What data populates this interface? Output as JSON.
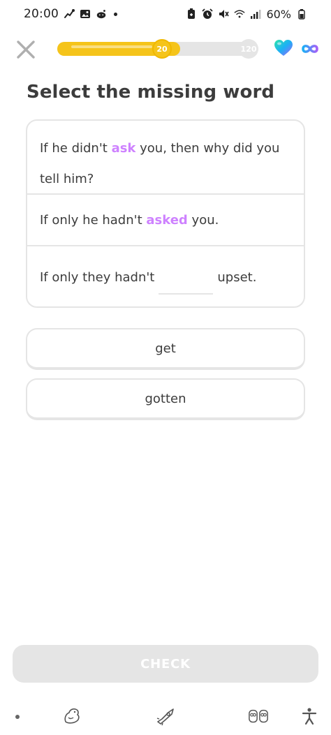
{
  "status_bar": {
    "time": "20:00",
    "battery": "60%",
    "icons": [
      "path-icon",
      "image-icon",
      "reddit-icon",
      "notification-dot",
      "battery-saver-icon",
      "alarm-icon",
      "mute-icon",
      "wifi-icon",
      "signal-icon",
      "battery-icon"
    ]
  },
  "header": {
    "close_icon": "close-icon",
    "progress": {
      "current": "20",
      "total": "120",
      "fraction": 0.61,
      "color": "#f5c41a"
    },
    "hearts_icon": "heart-gradient-icon",
    "hearts_value_icon": "infinity-icon",
    "accent": "#1cb0f6"
  },
  "exercise": {
    "title": "Select the missing word",
    "sentences": [
      {
        "before": "If he didn't ",
        "highlight": "ask",
        "after": " you, then why did you tell him?"
      },
      {
        "before": "If only he hadn't ",
        "highlight": "asked",
        "after": " you."
      },
      {
        "before": "If only they hadn't",
        "after": "upset."
      }
    ],
    "highlight_color": "#ce82ff",
    "options": [
      "get",
      "gotten"
    ]
  },
  "footer": {
    "check_label": "CHECK",
    "check_disabled": true
  },
  "bottom_nav": {
    "items": [
      "dot-icon",
      "dino-icon",
      "rocket-icon",
      "owls-icon",
      "accessibility-icon"
    ]
  }
}
